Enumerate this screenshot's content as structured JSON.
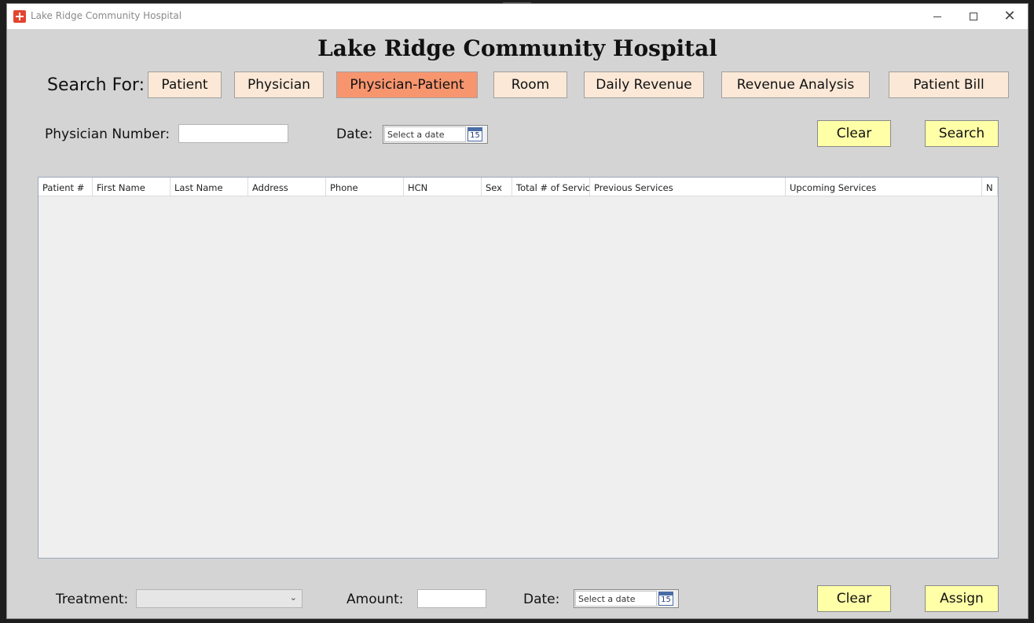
{
  "window": {
    "title": "Lake Ridge Community Hospital",
    "minimize": "—",
    "maximize": "☐",
    "close": "✕"
  },
  "heading": "Lake Ridge Community Hospital",
  "search": {
    "label": "Search For:",
    "tabs": [
      "Patient",
      "Physician",
      "Physician-Patient",
      "Room",
      "Daily Revenue",
      "Revenue Analysis",
      "Patient Bill"
    ],
    "active_tab": "Physician-Patient"
  },
  "filters": {
    "physician_number_label": "Physician Number:",
    "physician_number_value": "",
    "date_label": "Date:",
    "date_placeholder": "Select a date",
    "calendar_day": "15",
    "clear_label": "Clear",
    "search_label": "Search"
  },
  "grid": {
    "columns": [
      "Patient #",
      "First Name",
      "Last Name",
      "Address",
      "Phone",
      "HCN",
      "Sex",
      "Total # of Service",
      "Previous Services",
      "Upcoming Services",
      "N"
    ],
    "rows": []
  },
  "assign": {
    "treatment_label": "Treatment:",
    "treatment_value": "",
    "amount_label": "Amount:",
    "amount_value": "",
    "date_label": "Date:",
    "date_placeholder": "Select a date",
    "calendar_day": "15",
    "clear_label": "Clear",
    "assign_label": "Assign"
  },
  "colors": {
    "tab_default": "#fbe8d6",
    "tab_active": "#f7956f",
    "action_button": "#ffffa8",
    "window_bg": "#d4d4d4"
  }
}
